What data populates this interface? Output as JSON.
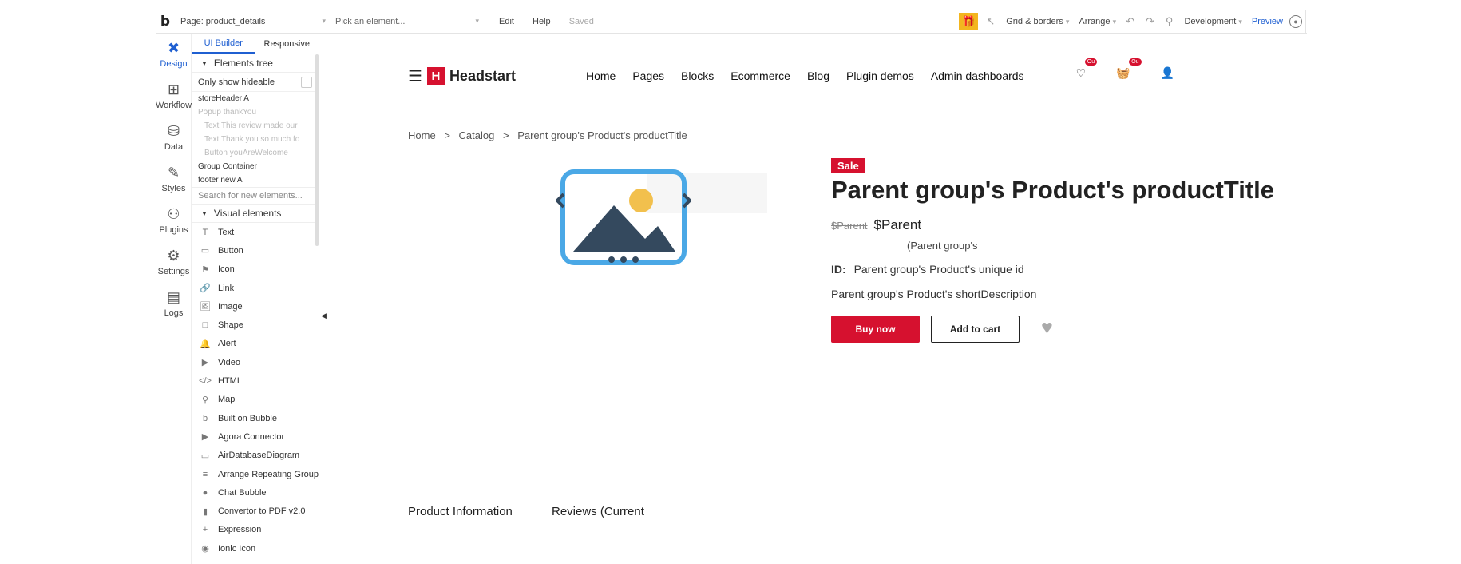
{
  "topbar": {
    "logo": "b",
    "page_label": "Page: product_details",
    "element_placeholder": "Pick an element...",
    "menu_edit": "Edit",
    "menu_help": "Help",
    "status": "Saved",
    "grid_borders": "Grid & borders",
    "arrange": "Arrange",
    "environment": "Development",
    "preview": "Preview"
  },
  "rail": [
    {
      "label": "Design",
      "icon": "design-icon",
      "active": true
    },
    {
      "label": "Workflow",
      "icon": "workflow-icon"
    },
    {
      "label": "Data",
      "icon": "database-icon"
    },
    {
      "label": "Styles",
      "icon": "brush-icon"
    },
    {
      "label": "Plugins",
      "icon": "plugin-icon"
    },
    {
      "label": "Settings",
      "icon": "gear-icon"
    },
    {
      "label": "Logs",
      "icon": "document-icon"
    }
  ],
  "panel": {
    "tab_ui_builder": "UI Builder",
    "tab_responsive": "Responsive",
    "elements_tree_title": "Elements tree",
    "only_show_hideable": "Only show hideable",
    "tree": [
      {
        "label": "storeHeader A",
        "dim": false,
        "indent": false
      },
      {
        "label": "Popup thankYou",
        "dim": true,
        "indent": false
      },
      {
        "label": "Text This review made our",
        "dim": true,
        "indent": true
      },
      {
        "label": "Text Thank you so much fo",
        "dim": true,
        "indent": true
      },
      {
        "label": "Button youAreWelcome",
        "dim": true,
        "indent": true
      },
      {
        "label": "Group Container",
        "dim": false,
        "indent": false
      },
      {
        "label": "footer new A",
        "dim": false,
        "indent": false
      }
    ],
    "search_placeholder": "Search for new elements...",
    "visual_elements_title": "Visual elements",
    "visual": [
      {
        "label": "Text",
        "glyph": "T"
      },
      {
        "label": "Button",
        "glyph": "▭"
      },
      {
        "label": "Icon",
        "glyph": "⚑"
      },
      {
        "label": "Link",
        "glyph": "🔗"
      },
      {
        "label": "Image",
        "glyph": "🖼"
      },
      {
        "label": "Shape",
        "glyph": "□"
      },
      {
        "label": "Alert",
        "glyph": "🔔"
      },
      {
        "label": "Video",
        "glyph": "▶"
      },
      {
        "label": "HTML",
        "glyph": "</>"
      },
      {
        "label": "Map",
        "glyph": "⚲"
      },
      {
        "label": "Built on Bubble",
        "glyph": "b"
      },
      {
        "label": "Agora Connector",
        "glyph": "▶"
      },
      {
        "label": "AirDatabaseDiagram",
        "glyph": "▭"
      },
      {
        "label": "Arrange Repeating Group",
        "glyph": "≡"
      },
      {
        "label": "Chat Bubble",
        "glyph": "●"
      },
      {
        "label": "Convertor to PDF v2.0",
        "glyph": "▮"
      },
      {
        "label": "Expression",
        "glyph": "+"
      },
      {
        "label": "Ionic Icon",
        "glyph": "◉"
      }
    ]
  },
  "site": {
    "brand": "Headstart",
    "brand_mark": "H",
    "nav": [
      "Home",
      "Pages",
      "Blocks",
      "Ecommerce",
      "Blog",
      "Plugin demos",
      "Admin dashboards"
    ],
    "wishlist_badge": "Ou",
    "cart_badge": "Ou"
  },
  "breadcrumb": [
    "Home",
    "Catalog",
    "Parent group's Product's productTitle"
  ],
  "breadcrumb_sep": ">",
  "product": {
    "sale": "Sale",
    "title": "Parent group's Product's productTitle",
    "old_price": "$Parent",
    "new_price": "$Parent",
    "price_sub": "(Parent group's",
    "id_label": "ID:",
    "id_value": "Parent group's Product's unique id",
    "short_description": "Parent group's Product's shortDescription",
    "buy_now": "Buy now",
    "add_to_cart": "Add to cart"
  },
  "tabs": {
    "info": "Product Information",
    "reviews": "Reviews (Current"
  },
  "colors": {
    "accent_red": "#d6112f",
    "bubble_blue": "#1f5fd1",
    "gift_yellow": "#f3b61f"
  }
}
